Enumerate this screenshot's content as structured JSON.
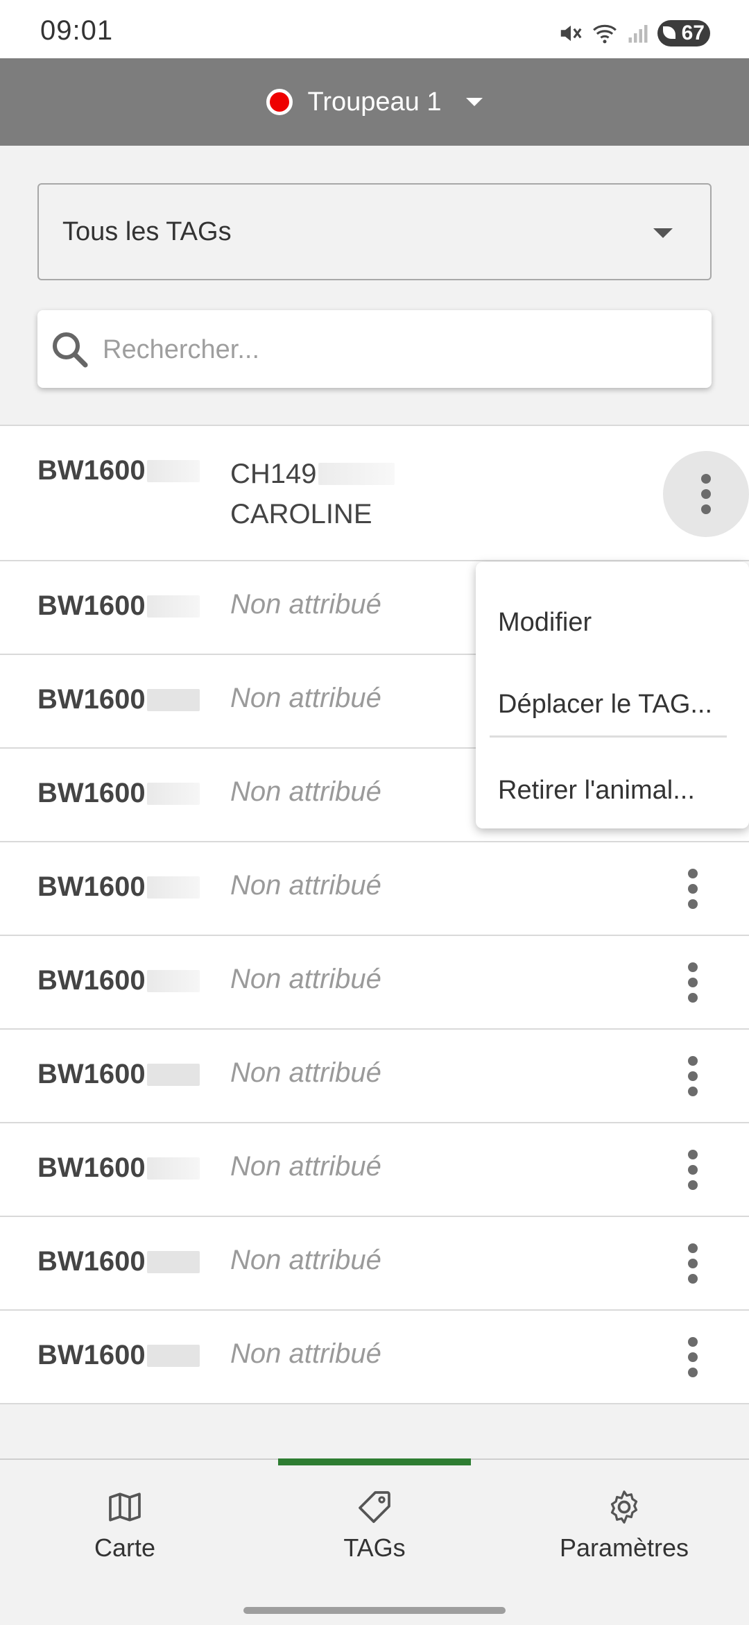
{
  "status_bar": {
    "time": "09:01",
    "battery": "67"
  },
  "header": {
    "herd_name": "Troupeau 1",
    "herd_color": "#ee0000"
  },
  "filter": {
    "label": "Tous les TAGs"
  },
  "search": {
    "placeholder": "Rechercher..."
  },
  "rows": [
    {
      "tag": "BW1600",
      "animal_id": "CH149",
      "animal_name": "CAROLINE"
    },
    {
      "tag": "BW1600",
      "animal": "Non attribué"
    },
    {
      "tag": "BW1600",
      "animal": "Non attribué"
    },
    {
      "tag": "BW1600",
      "animal": "Non attribué"
    },
    {
      "tag": "BW1600",
      "animal": "Non attribué"
    },
    {
      "tag": "BW1600",
      "animal": "Non attribué"
    },
    {
      "tag": "BW1600",
      "animal": "Non attribué"
    },
    {
      "tag": "BW1600",
      "animal": "Non attribué"
    },
    {
      "tag": "BW1600",
      "animal": "Non attribué"
    },
    {
      "tag": "BW1600",
      "animal": "Non attribué"
    }
  ],
  "menu": {
    "edit": "Modifier",
    "move_tag": "Déplacer le TAG...",
    "remove_animal": "Retirer l'animal..."
  },
  "bottom_nav": {
    "map": "Carte",
    "tags": "TAGs",
    "settings": "Paramètres",
    "active": "tags",
    "accent_color": "#2e7d32"
  }
}
